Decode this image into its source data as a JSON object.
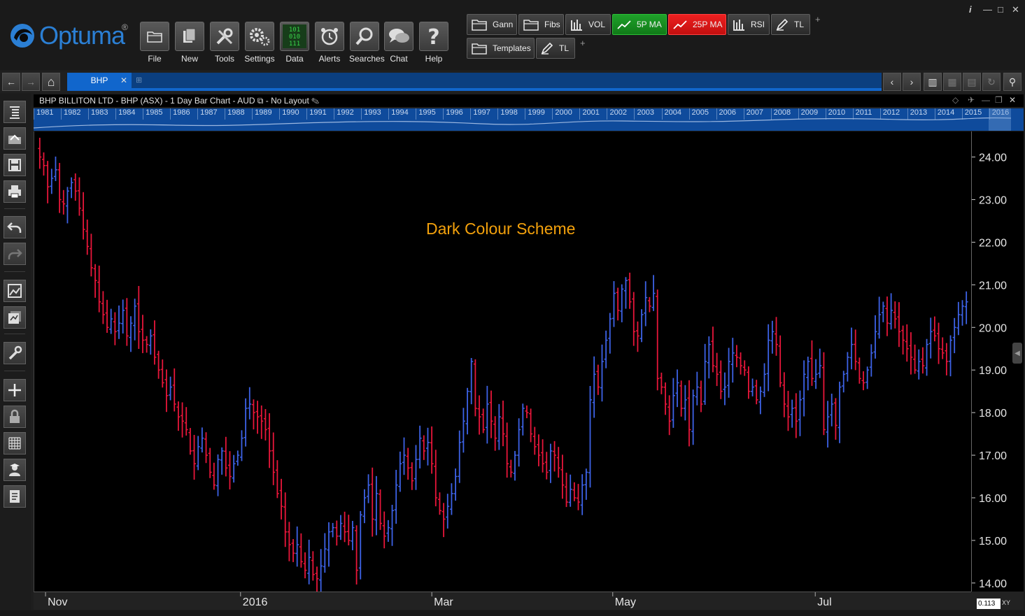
{
  "app": {
    "logo_text": "Optuma",
    "logo_mark": "®"
  },
  "toolbar": {
    "buttons": [
      {
        "label": "File",
        "icon": "folder-icon"
      },
      {
        "label": "New",
        "icon": "new-page-icon"
      },
      {
        "label": "Tools",
        "icon": "tools-icon"
      },
      {
        "label": "Settings",
        "icon": "gears-icon"
      },
      {
        "label": "Data",
        "icon": "binary-data-icon"
      },
      {
        "label": "Alerts",
        "icon": "alarm-clock-icon"
      },
      {
        "label": "Searches",
        "icon": "magnifier-icon"
      },
      {
        "label": "Chat",
        "icon": "chat-bubbles-icon"
      },
      {
        "label": "Help",
        "icon": "question-icon"
      }
    ]
  },
  "quick_buttons": {
    "row1": [
      {
        "label": "Gann",
        "icon": "folder-icon",
        "color": ""
      },
      {
        "label": "Fibs",
        "icon": "folder-icon",
        "color": ""
      },
      {
        "label": "VOL",
        "icon": "bar-chart-icon",
        "color": ""
      },
      {
        "label": "5P MA",
        "icon": "line-chart-icon",
        "color": "#1a9a25"
      },
      {
        "label": "25P MA",
        "icon": "line-chart-icon",
        "color": "#e01818"
      },
      {
        "label": "RSI",
        "icon": "bar-chart-icon",
        "color": ""
      },
      {
        "label": "TL",
        "icon": "pencil-icon",
        "color": ""
      }
    ],
    "row2": [
      {
        "label": "Templates",
        "icon": "folder-icon",
        "color": ""
      },
      {
        "label": "TL",
        "icon": "pencil-icon",
        "color": ""
      }
    ],
    "add_symbol": "+"
  },
  "window_controls": {
    "info": "i",
    "minimize": "—",
    "maximize": "□",
    "close": "✕"
  },
  "tabs": [
    {
      "label": "BHP",
      "close": "✕"
    }
  ],
  "chart": {
    "header_title": "BHP BILLITON LTD - BHP (ASX) - 1 Day Bar Chart - AUD",
    "layout_label": "No Layout",
    "overview_years": [
      "1981",
      "1982",
      "1983",
      "1984",
      "1985",
      "1986",
      "1987",
      "1988",
      "1989",
      "1990",
      "1991",
      "1992",
      "1993",
      "1994",
      "1995",
      "1996",
      "1997",
      "1998",
      "1999",
      "2000",
      "2001",
      "2002",
      "2003",
      "2004",
      "2005",
      "2006",
      "2007",
      "2008",
      "2009",
      "2010",
      "2011",
      "2012",
      "2013",
      "2014",
      "2015",
      "2016"
    ],
    "annotation": "Dark Colour Scheme",
    "coordinate_value": "0.113",
    "coordinate_mode": "XY",
    "up_color": "#3d62e6",
    "down_color": "#e8163a"
  },
  "chart_data": {
    "type": "bar",
    "subtype": "ohlc",
    "title": "",
    "x_tick_labels": [
      "Nov",
      "2016",
      "Mar",
      "May",
      "Jul"
    ],
    "y_tick_labels": [
      "14.00",
      "15.00",
      "16.00",
      "17.00",
      "18.00",
      "19.00",
      "20.00",
      "21.00",
      "22.00",
      "23.00",
      "24.00"
    ],
    "ylim": [
      13.8,
      24.6
    ],
    "grid": false,
    "closes": [
      24.0,
      23.8,
      23.3,
      23.5,
      23.7,
      23.0,
      22.9,
      23.2,
      23.4,
      23.2,
      22.8,
      22.3,
      21.9,
      21.4,
      21.1,
      20.6,
      20.3,
      20.0,
      20.2,
      19.9,
      20.1,
      20.4,
      19.8,
      20.1,
      20.5,
      19.9,
      19.7,
      19.6,
      19.8,
      19.3,
      19.0,
      18.7,
      18.4,
      18.6,
      18.2,
      17.9,
      17.8,
      17.6,
      17.1,
      16.8,
      17.2,
      17.4,
      17.0,
      16.6,
      16.3,
      16.9,
      17.1,
      16.7,
      16.5,
      16.8,
      17.0,
      17.4,
      18.1,
      18.2,
      18.0,
      17.9,
      17.8,
      17.6,
      17.1,
      16.6,
      16.1,
      15.8,
      15.2,
      14.9,
      14.7,
      14.9,
      14.5,
      14.3,
      14.6,
      14.2,
      14.1,
      14.4,
      14.8,
      15.2,
      15.3,
      15.1,
      15.4,
      15.2,
      15.0,
      15.3,
      14.3,
      15.6,
      16.0,
      16.3,
      15.5,
      16.1,
      15.4,
      15.1,
      15.3,
      15.7,
      16.3,
      16.8,
      17.0,
      16.7,
      16.4,
      16.9,
      17.4,
      17.1,
      17.3,
      16.8,
      16.0,
      15.7,
      15.5,
      15.8,
      16.1,
      16.5,
      17.3,
      17.8,
      18.5,
      19.2,
      18.1,
      17.9,
      17.6,
      18.2,
      17.8,
      17.4,
      17.9,
      17.5,
      16.8,
      16.6,
      17.0,
      17.6,
      18.1,
      18.0,
      17.5,
      17.2,
      17.0,
      16.8,
      16.6,
      17.1,
      17.0,
      16.7,
      16.3,
      15.9,
      16.2,
      16.0,
      15.9,
      16.3,
      16.6,
      18.3,
      18.9,
      18.6,
      19.2,
      19.7,
      20.2,
      20.8,
      20.4,
      20.9,
      21.1,
      20.6,
      19.9,
      19.8,
      20.3,
      20.7,
      20.5,
      20.8,
      18.8,
      18.6,
      18.2,
      17.8,
      18.4,
      18.7,
      18.1,
      18.3,
      17.6,
      18.4,
      18.6,
      18.2,
      19.2,
      19.6,
      19.1,
      18.9,
      18.5,
      18.6,
      19.2,
      19.4,
      19.3,
      19.1,
      19.0,
      18.5,
      18.6,
      18.3,
      18.5,
      18.9,
      19.7,
      19.9,
      19.6,
      18.7,
      18.2,
      17.9,
      18.1,
      17.8,
      18.3,
      18.9,
      19.2,
      18.8,
      18.9,
      19.1,
      17.6,
      17.9,
      18.2,
      17.7,
      18.6,
      18.9,
      19.3,
      19.6,
      19.2,
      18.8,
      18.7,
      19.0,
      19.4,
      19.9,
      20.3,
      20.5,
      20.1,
      20.4,
      20.2,
      19.9,
      19.7,
      19.5,
      19.3,
      19.0,
      19.2,
      19.1,
      19.6,
      19.9,
      19.8,
      19.5,
      19.4,
      19.2,
      19.7,
      20.0,
      20.3,
      20.5,
      20.6
    ]
  },
  "left_tools": [
    {
      "icon": "chart-list-icon"
    },
    {
      "icon": "open-workbook-icon"
    },
    {
      "icon": "save-icon"
    },
    {
      "icon": "print-icon"
    },
    {
      "icon": "undo-icon"
    },
    {
      "icon": "redo-icon"
    },
    {
      "icon": "chart-image-icon"
    },
    {
      "icon": "export-icon"
    },
    {
      "icon": "wrench-icon"
    },
    {
      "icon": "crosshair-icon"
    },
    {
      "icon": "lock-icon"
    },
    {
      "icon": "grid-icon"
    },
    {
      "icon": "user-icon"
    },
    {
      "icon": "notes-icon"
    }
  ],
  "nav": {
    "back": "←",
    "forward": "→",
    "home": "⌂"
  }
}
